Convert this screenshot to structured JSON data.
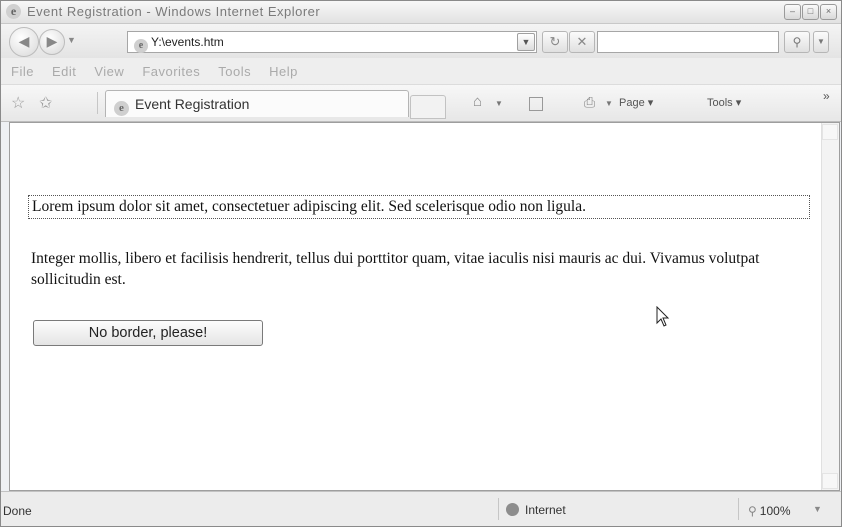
{
  "window": {
    "title": "Event Registration - Windows Internet Explorer",
    "controls": [
      "–",
      "□",
      "×"
    ]
  },
  "address": {
    "url": "Y:\\events.htm"
  },
  "menu": [
    "File",
    "Edit",
    "View",
    "Favorites",
    "Tools",
    "Help"
  ],
  "toolbar": {
    "tab_title": "Event Registration",
    "page_label": "Page ▾",
    "tools_label": "Tools ▾",
    "more": "»"
  },
  "page": {
    "para1": "Lorem ipsum dolor sit amet, consectetuer adipiscing elit. Sed scelerisque odio non ligula.",
    "para2": "Integer mollis, libero et facilisis hendrerit, tellus dui porttitor quam, vitae iaculis nisi mauris ac dui. Vivamus volutpat sollicitudin est.",
    "button": "No border, please!"
  },
  "status": {
    "text": "Done",
    "zone": "Internet",
    "zoom": "100%"
  }
}
